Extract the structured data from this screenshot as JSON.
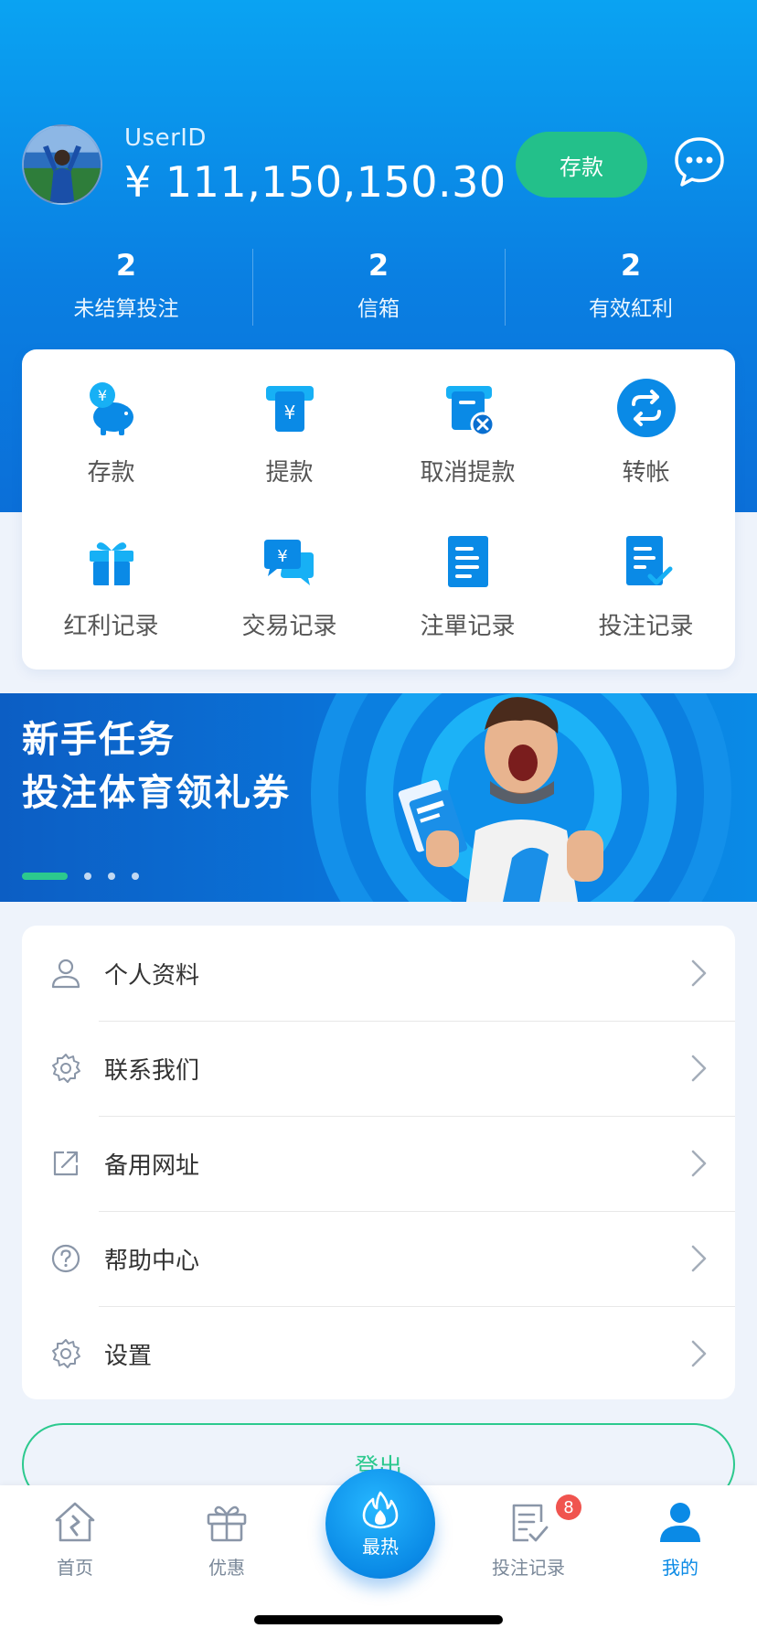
{
  "header": {
    "user_id": "UserID",
    "balance": "¥ 111,150,150.30",
    "deposit_button": "存款",
    "chat_icon": "chat-bubble-icon"
  },
  "stats": [
    {
      "value": "2",
      "label": "未结算投注"
    },
    {
      "value": "2",
      "label": "信箱"
    },
    {
      "value": "2",
      "label": "有效紅利"
    }
  ],
  "actions": [
    {
      "label": "存款",
      "icon": "piggy-bank-icon"
    },
    {
      "label": "提款",
      "icon": "withdraw-icon"
    },
    {
      "label": "取消提款",
      "icon": "cancel-withdraw-icon"
    },
    {
      "label": "转帐",
      "icon": "transfer-icon"
    },
    {
      "label": "红利记录",
      "icon": "gift-icon"
    },
    {
      "label": "交易记录",
      "icon": "transaction-icon"
    },
    {
      "label": "注單记录",
      "icon": "bet-slip-icon"
    },
    {
      "label": "投注记录",
      "icon": "bet-record-icon"
    }
  ],
  "banner": {
    "line1": "新手任务",
    "line2": "投注体育领礼券",
    "active_slide": 1,
    "slide_count": 4
  },
  "menu": [
    {
      "label": "个人资料",
      "icon": "user-icon"
    },
    {
      "label": "联系我们",
      "icon": "gear-icon"
    },
    {
      "label": "备用网址",
      "icon": "external-link-icon"
    },
    {
      "label": "帮助中心",
      "icon": "help-icon"
    },
    {
      "label": "设置",
      "icon": "settings-icon"
    }
  ],
  "logout": "登出",
  "tabbar": {
    "home": "首页",
    "promo": "优惠",
    "hot": "最热",
    "bets": "投注记录",
    "bets_badge": "8",
    "mine": "我的"
  },
  "colors": {
    "primary": "#0a8ae6",
    "green": "#23c08a",
    "badge": "#f0544f"
  }
}
